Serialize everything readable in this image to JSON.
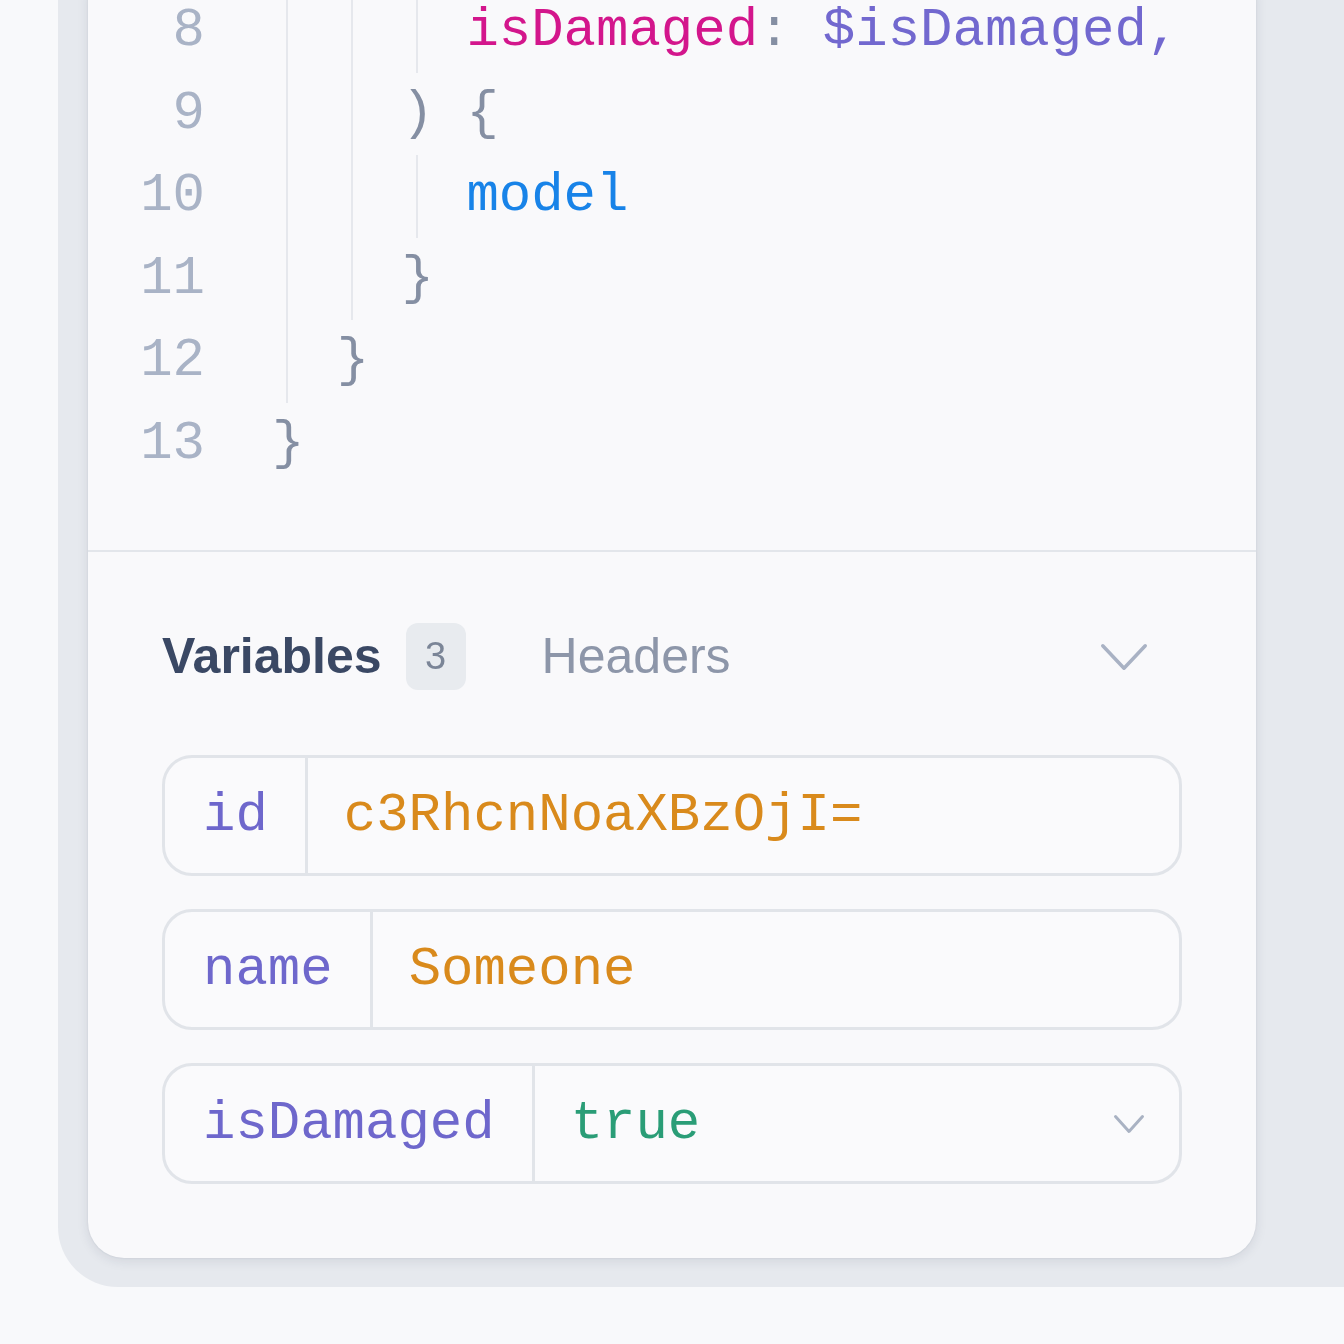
{
  "editor": {
    "lines": [
      {
        "number": "8",
        "tokens": [
          {
            "kind": "argument",
            "text": "      isDamaged"
          },
          {
            "kind": "punctuation",
            "text": ": "
          },
          {
            "kind": "variable",
            "text": "$isDamaged,"
          }
        ]
      },
      {
        "number": "9",
        "tokens": [
          {
            "kind": "punctuation",
            "text": "    ) {"
          }
        ]
      },
      {
        "number": "10",
        "tokens": [
          {
            "kind": "field",
            "text": "      model"
          }
        ]
      },
      {
        "number": "11",
        "tokens": [
          {
            "kind": "punctuation",
            "text": "    }"
          }
        ]
      },
      {
        "number": "12",
        "tokens": [
          {
            "kind": "punctuation",
            "text": "  }"
          }
        ]
      },
      {
        "number": "13",
        "tokens": [
          {
            "kind": "punctuation",
            "text": "}"
          }
        ]
      }
    ]
  },
  "variables_panel": {
    "tabs": [
      {
        "label": "Variables",
        "count": "3",
        "selected": true
      },
      {
        "label": "Headers",
        "selected": false
      }
    ],
    "rows": [
      {
        "kind": "string",
        "name": "id",
        "value": "c3RhcnNoaXBzOjI="
      },
      {
        "kind": "string",
        "name": "name",
        "value": "Someone"
      },
      {
        "kind": "boolean",
        "name": "isDamaged",
        "value": "true"
      }
    ]
  }
}
